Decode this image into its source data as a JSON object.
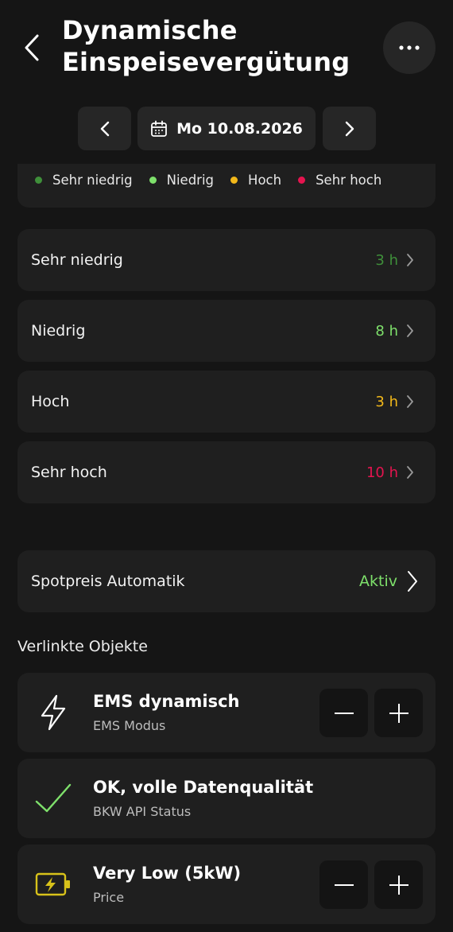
{
  "header": {
    "title_line1": "Dynamische",
    "title_line2": "Einspeisevergütung",
    "back_icon": "chevron-left-icon",
    "more_icon": "more-horizontal-icon"
  },
  "date_nav": {
    "prev_icon": "chevron-left-icon",
    "next_icon": "chevron-right-icon",
    "calendar_icon": "calendar-icon",
    "date": "Mo 10.08.2026"
  },
  "legend": [
    {
      "label": "Sehr niedrig",
      "color": "#3f8f3a"
    },
    {
      "label": "Niedrig",
      "color": "#7ee06b"
    },
    {
      "label": "Hoch",
      "color": "#f2b81a"
    },
    {
      "label": "Sehr hoch",
      "color": "#e5144f"
    }
  ],
  "categories": [
    {
      "label": "Sehr niedrig",
      "value": "3 h",
      "color": "#3f8f3a"
    },
    {
      "label": "Niedrig",
      "value": "8 h",
      "color": "#7ee06b"
    },
    {
      "label": "Hoch",
      "value": "3 h",
      "color": "#f2b81a"
    },
    {
      "label": "Sehr hoch",
      "value": "10 h",
      "color": "#e5144f"
    }
  ],
  "automation": {
    "label": "Spotpreis Automatik",
    "status": "Aktiv",
    "status_color": "#7ee06b"
  },
  "linked": {
    "title": "Verlinkte Objekte",
    "items": [
      {
        "title": "EMS dynamisch",
        "subtitle": "EMS Modus",
        "icon": "lightning-icon"
      },
      {
        "title": "OK, volle Datenqualität",
        "subtitle": "BKW API Status",
        "icon": "checkmark-icon"
      },
      {
        "title": "Very Low (5kW)",
        "subtitle": "Price",
        "icon": "battery-charging-icon"
      }
    ]
  }
}
